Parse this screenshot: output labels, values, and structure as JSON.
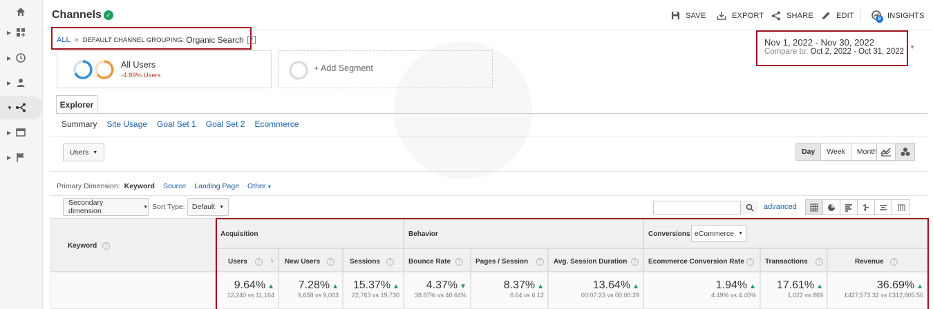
{
  "header": {
    "title": "Channels",
    "actions": [
      {
        "label": "SAVE",
        "icon": "save-icon"
      },
      {
        "label": "EXPORT",
        "icon": "export-icon"
      },
      {
        "label": "SHARE",
        "icon": "share-icon"
      },
      {
        "label": "EDIT",
        "icon": "pencil-icon"
      },
      {
        "label": "INSIGHTS",
        "icon": "insights-icon",
        "badge": "9"
      }
    ]
  },
  "breadcrumb": {
    "all": "ALL",
    "separator": "»",
    "grouping": "DEFAULT CHANNEL GROUPING:",
    "value": "Organic Search"
  },
  "date_range": {
    "main": "Nov 1, 2022 - Nov 30, 2022",
    "compare_label": "Compare to:",
    "compare_value": "Oct 2, 2022 - Oct 31, 2022"
  },
  "segments": {
    "active_name": "All Users",
    "active_sub": "-4.89% Users",
    "add_label": "+ Add Segment"
  },
  "tabs": {
    "explorer": "Explorer",
    "subtabs": [
      "Summary",
      "Site Usage",
      "Goal Set 1",
      "Goal Set 2",
      "Ecommerce"
    ]
  },
  "controls": {
    "metric_select": "Users",
    "time_buttons": [
      "Day",
      "Week",
      "Month"
    ],
    "primary_dimension_label": "Primary Dimension:",
    "primary_dimensions": [
      "Keyword",
      "Source",
      "Landing Page",
      "Other"
    ],
    "secondary_dimension": "Secondary dimension",
    "sort_type_label": "Sort Type:",
    "sort_type": "Default",
    "advanced": "advanced"
  },
  "table": {
    "keyword_header": "Keyword",
    "groups": {
      "acquisition": "Acquisition",
      "behavior": "Behavior",
      "conversions": "Conversions",
      "conversions_select": "eCommerce"
    },
    "columns": [
      {
        "label": "Users",
        "pct": "9.64%",
        "vs": "12,240 vs 11,164"
      },
      {
        "label": "New Users",
        "pct": "7.28%",
        "vs": "9,658 vs 9,003"
      },
      {
        "label": "Sessions",
        "pct": "15.37%",
        "vs": "22,763 vs 19,730"
      },
      {
        "label": "Bounce Rate",
        "pct": "4.37%",
        "vs": "38.87% vs 40.64%"
      },
      {
        "label": "Pages / Session",
        "pct": "8.37%",
        "vs": "6.64 vs 6.12"
      },
      {
        "label": "Avg. Session Duration",
        "pct": "13.64%",
        "vs": "00:07:23 vs 00:06:29"
      },
      {
        "label": "Ecommerce Conversion Rate",
        "pct": "1.94%",
        "vs": "4.49% vs 4.40%"
      },
      {
        "label": "Transactions",
        "pct": "17.61%",
        "vs": "1,022 vs 869"
      },
      {
        "label": "Revenue",
        "pct": "36.69%",
        "vs": "£427,573.32 vs £312,805.50"
      }
    ]
  },
  "colors": {
    "accent_red": "#a0141e",
    "link_blue": "#1a5fa8",
    "green_up": "#1e9e5a"
  }
}
